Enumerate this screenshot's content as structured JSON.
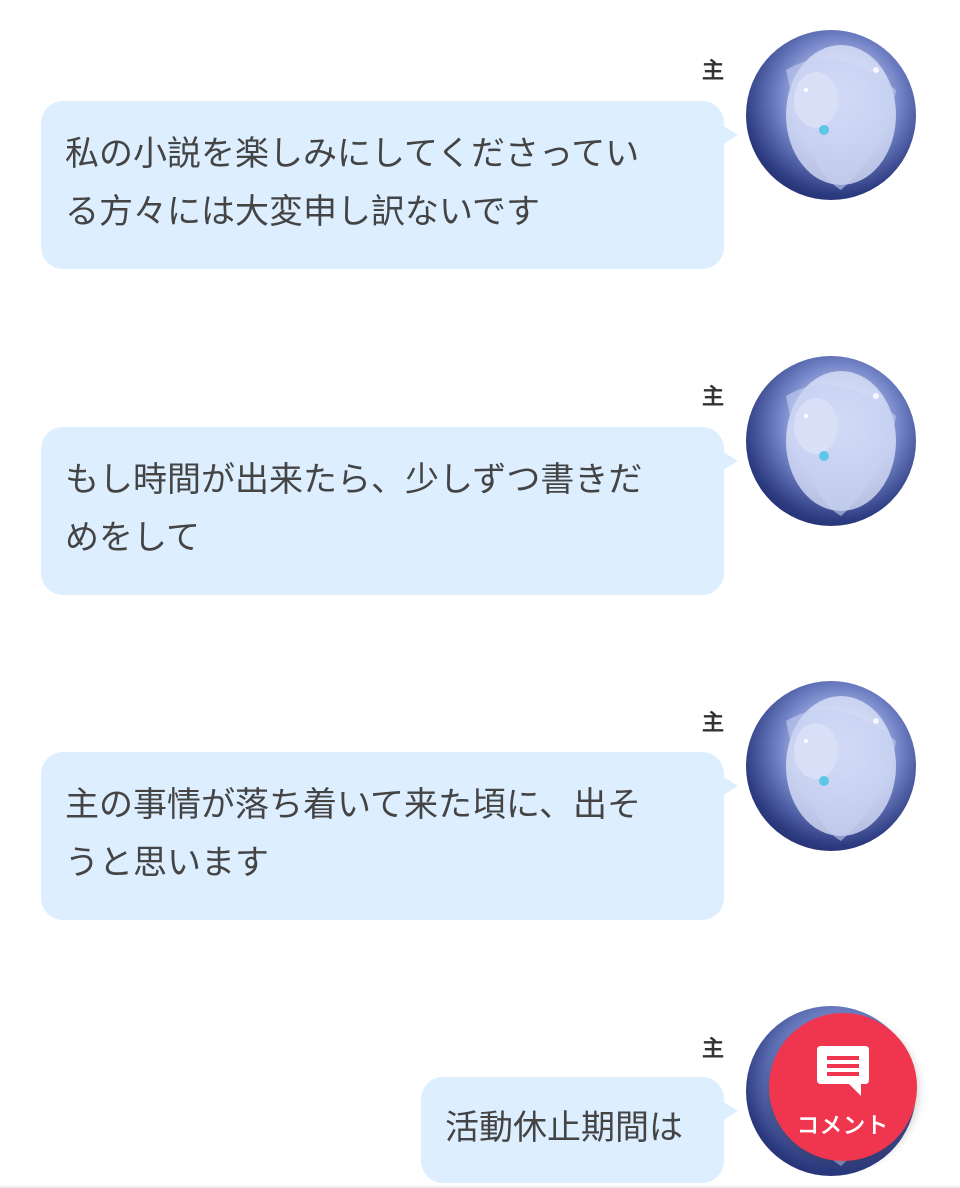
{
  "messages": [
    {
      "speaker": "主",
      "line1": "私の小説を楽しみにしてくださってい",
      "line2": "る方々には大変申し訳ないです"
    },
    {
      "speaker": "主",
      "line1": "もし時間が出来たら、少しずつ書きだ",
      "line2": "めをして"
    },
    {
      "speaker": "主",
      "line1": "主の事情が落ち着いて来た頃に、出そ",
      "line2": "うと思います"
    },
    {
      "speaker": "主",
      "line1": "活動休止期間は",
      "line2": ""
    }
  ],
  "comment_button": {
    "label": "コメント",
    "icon": "comment-icon"
  },
  "colors": {
    "bubble": "#ddeeff",
    "fab": "#f0354e",
    "text": "#444444"
  }
}
